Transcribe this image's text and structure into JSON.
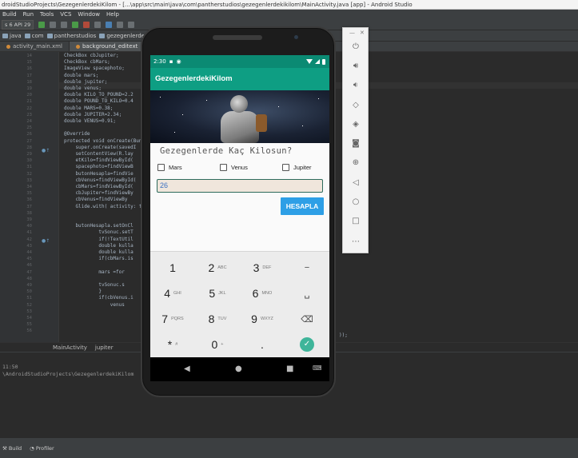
{
  "ide": {
    "title": "droidStudioProjects\\GezegenlerdekiKilom - [...\\app\\src\\main\\java\\com\\pantherstudios\\gezegenlerdekikilom\\MainActivity.java [app] - Android Studio",
    "menu": [
      "Build",
      "Run",
      "Tools",
      "VCS",
      "Window",
      "Help"
    ],
    "device_selector": "s 6 API 29",
    "breadcrumbs": [
      "java",
      "com",
      "pantherstudios",
      "gezegenlerdeki"
    ],
    "file_tabs": [
      "activity_main.xml",
      "background_editext"
    ],
    "line_numbers": [
      "14",
      "15",
      "16",
      "17",
      "18",
      "19",
      "20",
      "21",
      "22",
      "23",
      "24",
      "25",
      "26",
      "27",
      "28",
      "29",
      "30",
      "31",
      "32",
      "33",
      "34",
      "35",
      "36",
      "37",
      "38",
      "39",
      "40",
      "41",
      "42",
      "43",
      "44",
      "45",
      "46",
      "47",
      "48",
      "49",
      "50",
      "51",
      "52",
      "53",
      "54",
      "55",
      "56"
    ],
    "code_lines": [
      "CheckBox cbJupiter;",
      "CheckBox cbMars;",
      "ImageView spacephoto;",
      "double mars;",
      "double jupiter;",
      "double venus;",
      "double KILO_TO_POUND=2.2",
      "double POUND_TO_KILO=0.4",
      "double MARS=0.38;",
      "double JUPITER=2.34;",
      "double VENUS=0.91;",
      "",
      "@Override",
      "protected void onCreate(Bundl",
      "    super.onCreate(savedI",
      "    setContentView(R.lay",
      "    etKilo=findViewById(",
      "    spacephoto=findViewB",
      "    butonHesapla=findVie",
      "    cbVenus=findViewById(",
      "    cbMars=findViewById(",
      "    cbJupiter=findViewBy",
      "    cbVenus=findViewBy",
      "    Glide.with( activity: th",
      "",
      "",
      "    butonHesapla.setOnCl",
      "            tvSonuc.setT",
      "            if(!TextUtil",
      "            double kulla",
      "            double kulla",
      "            if(cbMars.is",
      "",
      "            mars =for",
      "",
      "            tvSonuc.s",
      "            }",
      "            if(cbVenus.i",
      "                venus",
      "",
      "",
      "",
      ""
    ],
    "code_line_tail": "));",
    "bottom_crumbs": [
      "MainActivity",
      "jupiter"
    ],
    "bottom_panel": [
      "11:50",
      "\\AndroidStudioProjects\\GezegenlerdekiKilom"
    ],
    "status_tabs": [
      "Build",
      "Profiler"
    ]
  },
  "emulator_panel": {
    "controls": [
      "—",
      "✕"
    ],
    "buttons": [
      "power-icon",
      "volume-up-icon",
      "volume-down-icon",
      "rotate-left-icon",
      "rotate-right-icon",
      "camera-icon",
      "zoom-icon",
      "back-icon",
      "home-icon",
      "overview-icon",
      "more-icon"
    ]
  },
  "phone": {
    "status_time": "2:30",
    "app_title": "GezegenlerdekiKilom",
    "question": "Gezegenlerde Kaç Kilosun?",
    "checkboxes": [
      {
        "label": "Mars",
        "checked": false
      },
      {
        "label": "Venus",
        "checked": false
      },
      {
        "label": "Jupiter",
        "checked": false
      }
    ],
    "weight_input_value": "26",
    "calc_button": "HESAPLA",
    "keyboard": [
      [
        {
          "main": "1",
          "sub": ""
        },
        {
          "main": "2",
          "sub": "ABC"
        },
        {
          "main": "3",
          "sub": "DEF"
        },
        {
          "main": "−",
          "sub": ""
        }
      ],
      [
        {
          "main": "4",
          "sub": "GHI"
        },
        {
          "main": "5",
          "sub": "JKL"
        },
        {
          "main": "6",
          "sub": "MNO"
        },
        {
          "main": "␣",
          "sub": ""
        }
      ],
      [
        {
          "main": "7",
          "sub": "PQRS"
        },
        {
          "main": "8",
          "sub": "TUV"
        },
        {
          "main": "9",
          "sub": "WXYZ"
        },
        {
          "main": "⌫",
          "sub": ""
        }
      ],
      [
        {
          "main": "*",
          "sub": "#"
        },
        {
          "main": "0",
          "sub": "+"
        },
        {
          "main": ".",
          "sub": ""
        },
        {
          "main": "✓",
          "sub": ""
        }
      ]
    ],
    "nav": [
      "◀",
      "●",
      "■",
      "⌨"
    ],
    "colors": {
      "appbar": "#0e9e83",
      "statusbar": "#0b8a73",
      "button": "#2e9fe6",
      "input_bg": "#f0e6dc"
    }
  }
}
